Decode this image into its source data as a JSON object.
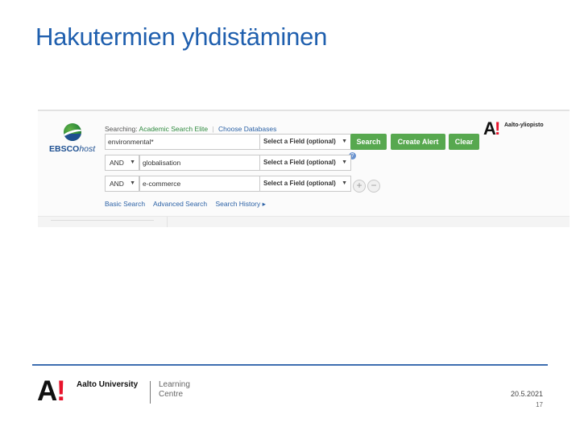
{
  "slide": {
    "title": "Hakutermien yhdistäminen",
    "colors": {
      "title": "#1f5fae",
      "rule": "#3e6eb0"
    }
  },
  "ebsco": {
    "logo_brand": "EBSCO",
    "logo_host": "host",
    "searching_label": "Searching:",
    "database": "Academic Search Elite",
    "choose_databases": "Choose Databases",
    "rows": [
      {
        "boolean": "",
        "term": "environmental*",
        "field": "Select a Field (optional)"
      },
      {
        "boolean": "AND",
        "term": "globalisation",
        "field": "Select a Field (optional)"
      },
      {
        "boolean": "AND",
        "term": "e-commerce",
        "field": "Select a Field (optional)"
      }
    ],
    "buttons": {
      "search": "Search",
      "create_alert": "Create Alert",
      "clear": "Clear"
    },
    "help": "?",
    "add_row": "+",
    "remove_row": "−",
    "links": {
      "basic": "Basic Search",
      "advanced": "Advanced Search",
      "history": "Search History ▸"
    },
    "institution_logo_letter": "A",
    "institution_logo_mark": "!",
    "institution_name": "Aalto-yliopisto",
    "colors": {
      "button": "#57a84f",
      "link": "#2c62a6",
      "database": "#2f8a3f"
    }
  },
  "footer": {
    "logo_letter": "A",
    "logo_mark": "!",
    "university": "Aalto University",
    "unit_line1": "Learning",
    "unit_line2": "Centre",
    "date": "20.5.2021",
    "page": "17",
    "colors": {
      "logo_mark": "#e8132b"
    }
  }
}
